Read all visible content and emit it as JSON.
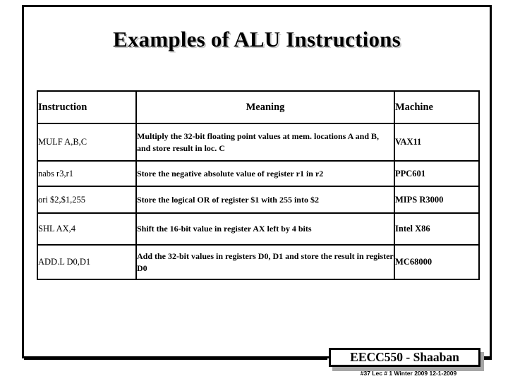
{
  "slide": {
    "title": "Examples of ALU Instructions"
  },
  "table": {
    "headers": {
      "instruction": "Instruction",
      "meaning": "Meaning",
      "machine": "Machine"
    },
    "rows": [
      {
        "instruction": "MULF A,B,C",
        "meaning": "Multiply the 32-bit floating point values at mem. locations A and B, and store result in loc. C",
        "machine": "VAX11"
      },
      {
        "instruction": "nabs r3,r1",
        "meaning": "Store the negative absolute value of register r1 in r2",
        "machine": "PPC601"
      },
      {
        "instruction": "ori $2,$1,255",
        "meaning": "Store the logical OR of register $1 with 255 into $2",
        "machine": "MIPS R3000"
      },
      {
        "instruction": "SHL AX,4",
        "meaning": "Shift the 16-bit value in register AX left by 4 bits",
        "machine": "Intel X86"
      },
      {
        "instruction": "ADD.L D0,D1",
        "meaning": "Add the 32-bit values in registers D0, D1 and store the result in register D0",
        "machine": "MC68000"
      }
    ]
  },
  "footer": {
    "course": "EECC550 - Shaaban",
    "meta": "#37   Lec # 1  Winter 2009  12-1-2009"
  },
  "colors": {
    "background": "#ffffff",
    "border": "#000000",
    "title_shadow": "#c8c8c8",
    "box_shadow": "#a6a6a6",
    "text": "#000000"
  }
}
